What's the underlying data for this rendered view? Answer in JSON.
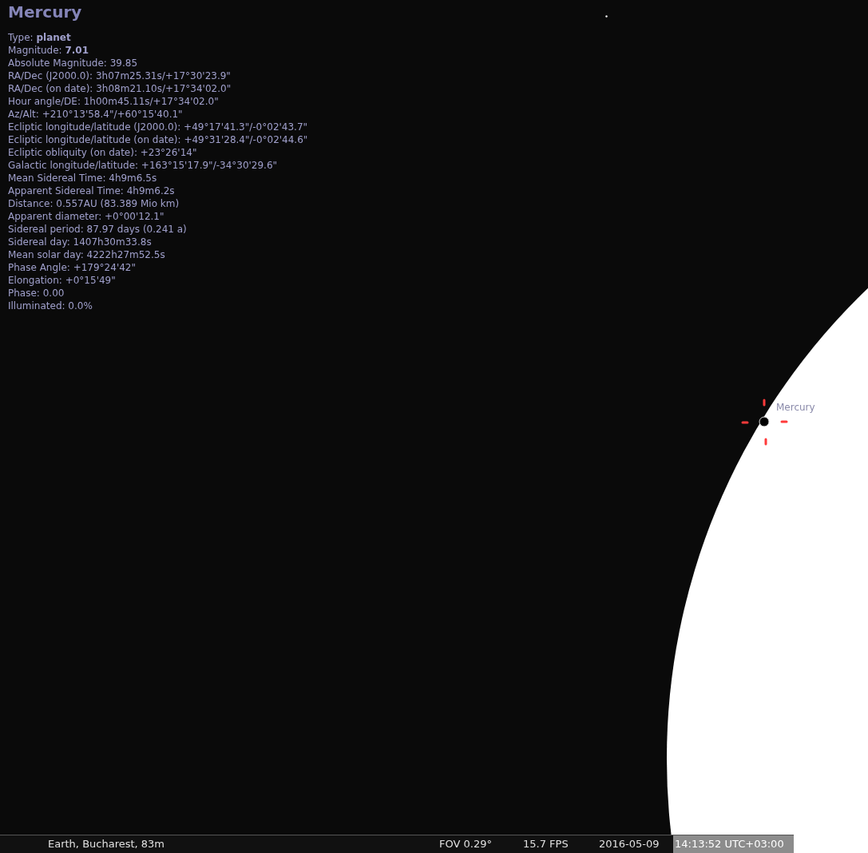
{
  "object": {
    "title": "Mercury",
    "info": [
      "Type: **planet**",
      "Magnitude: **7.01**",
      "Absolute Magnitude: 39.85",
      "RA/Dec (J2000.0): 3h07m25.31s/+17°30'23.9\"",
      "RA/Dec (on date): 3h08m21.10s/+17°34'02.0\"",
      "Hour angle/DE: 1h00m45.11s/+17°34'02.0\"",
      "Az/Alt: +210°13'58.4\"/+60°15'40.1\"",
      "Ecliptic longitude/latitude (J2000.0): +49°17'41.3\"/-0°02'43.7\"",
      "Ecliptic longitude/latitude (on date): +49°31'28.4\"/-0°02'44.6\"",
      "Ecliptic obliquity (on date): +23°26'14\"",
      "Galactic longitude/latitude: +163°15'17.9\"/-34°30'29.6\"",
      "Mean Sidereal Time: 4h9m6.5s",
      "Apparent Sidereal Time: 4h9m6.2s",
      "Distance: 0.557AU (83.389 Mio km)",
      "Apparent diameter: +0°00'12.1\"",
      "Sidereal period: 87.97 days (0.241 a)",
      "Sidereal day: 1407h30m33.8s",
      "Mean solar day: 4222h27m52.5s",
      "Phase Angle: +179°24'42\"",
      "Elongation: +0°15'49\"",
      "Phase: 0.00",
      "Illuminated: 0.0%"
    ]
  },
  "sky": {
    "object_label": "Mercury"
  },
  "status_bar": {
    "location": "Earth, Bucharest, 83m",
    "fov": "FOV 0.29°",
    "fps": "15.7 FPS",
    "date": "2016-05-09",
    "time": "14:13:52 UTC+03:00"
  }
}
